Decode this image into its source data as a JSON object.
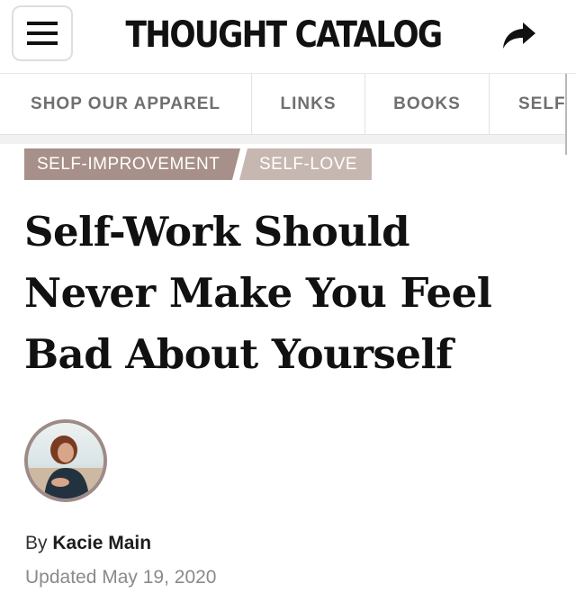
{
  "header": {
    "brand": "THOUGHT CATALOG",
    "menu_icon": "hamburger-menu-icon",
    "share_icon": "share-arrow-icon"
  },
  "nav": {
    "items": [
      "SHOP OUR APPAREL",
      "LINKS",
      "BOOKS",
      "SELF"
    ]
  },
  "tags": [
    "SELF-IMPROVEMENT",
    "SELF-LOVE"
  ],
  "article": {
    "headline_lines": [
      "Self-Work Should",
      "Never Make You Feel",
      "Bad About Yourself"
    ],
    "by_label": "By",
    "author": "Kacie Main",
    "updated": "Updated May 19, 2020"
  },
  "colors": {
    "tag_primary": "#a79089",
    "tag_secondary": "#c7b7b1",
    "avatar_ring": "#9e8a87",
    "nav_text": "#6f6f6f",
    "meta_text": "#8a8a8a"
  }
}
